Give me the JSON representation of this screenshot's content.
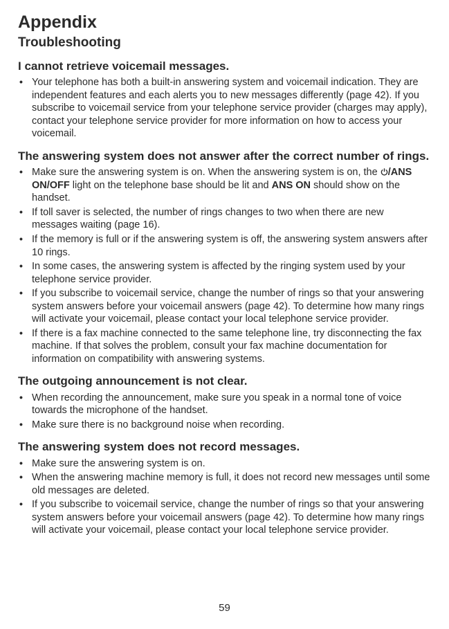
{
  "title": "Appendix",
  "subtitle": "Troubleshooting",
  "pageNumber": "59",
  "sections": [
    {
      "heading": "I cannot retrieve voicemail messages.",
      "items": [
        {
          "text": "Your telephone has both a built-in answering system and voicemail indication. They are independent features and each alerts you to new messages differently (page 42). If you subscribe to voicemail service from your telephone service provider (charges may apply), contact your telephone service provider for more information on how to access your voicemail."
        }
      ]
    },
    {
      "heading": "The answering system does not answer after the correct number of rings.",
      "items": [
        {
          "prefix": "Make sure the answering system is on. When the answering system is on, the ",
          "icon": true,
          "bold1": "/ANS ON/OFF",
          "mid": " light on the telephone base should be lit and ",
          "bold2": "ANS ON",
          "suffix": " should show on the handset."
        },
        {
          "text": "If toll saver is selected, the number of rings changes to two when there are new messages waiting (page 16)."
        },
        {
          "text": "If the memory is full or if the answering system is off, the answering system answers after 10 rings."
        },
        {
          "text": "In some cases, the answering system is affected by the ringing system used by your telephone service provider."
        },
        {
          "text": "If you subscribe to voicemail service, change the number of rings so that your answering system answers before your voicemail answers (page 42). To determine how many rings will activate your voicemail, please contact your local telephone service provider."
        },
        {
          "text": "If there is a fax machine connected to the same telephone line, try disconnecting the fax machine. If that solves the problem, consult your fax machine documentation for information on compatibility with answering systems."
        }
      ]
    },
    {
      "heading": "The outgoing announcement is not clear.",
      "items": [
        {
          "text": "When recording the announcement, make sure you speak in a normal tone of voice towards the microphone of the handset."
        },
        {
          "text": "Make sure there is no background noise when recording."
        }
      ]
    },
    {
      "heading": "The answering system does not record messages.",
      "items": [
        {
          "text": "Make sure the answering system is on."
        },
        {
          "text": "When the answering machine memory is full, it does not record new messages until some old messages are deleted."
        },
        {
          "text": "If you subscribe to voicemail service, change the number of rings so that your answering system answers before your voicemail answers (page 42). To determine how many rings will activate your voicemail, please contact your local telephone service provider."
        }
      ]
    }
  ]
}
